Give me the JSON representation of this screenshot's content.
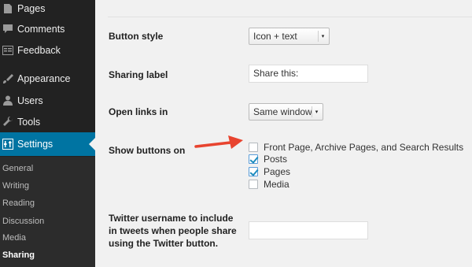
{
  "sidebar": {
    "items": [
      {
        "label": "Pages",
        "icon": "pages-icon"
      },
      {
        "label": "Comments",
        "icon": "comments-icon"
      },
      {
        "label": "Feedback",
        "icon": "feedback-icon"
      },
      {
        "label": "Appearance",
        "icon": "appearance-icon"
      },
      {
        "label": "Users",
        "icon": "users-icon"
      },
      {
        "label": "Tools",
        "icon": "tools-icon"
      },
      {
        "label": "Settings",
        "icon": "settings-icon"
      }
    ],
    "submenu": [
      "General",
      "Writing",
      "Reading",
      "Discussion",
      "Media",
      "Sharing"
    ],
    "active_item": "Settings",
    "current_submenu": "Sharing"
  },
  "form": {
    "button_style": {
      "label": "Button style",
      "value": "Icon + text"
    },
    "sharing_label": {
      "label": "Sharing label",
      "value": "Share this:"
    },
    "open_links": {
      "label": "Open links in",
      "value": "Same window"
    },
    "show_buttons": {
      "label": "Show buttons on",
      "options": [
        {
          "label": "Front Page, Archive Pages, and Search Results",
          "checked": false
        },
        {
          "label": "Posts",
          "checked": true
        },
        {
          "label": "Pages",
          "checked": true
        },
        {
          "label": "Media",
          "checked": false
        }
      ]
    },
    "twitter": {
      "label_line1": "Twitter username to include",
      "label_line2": "in tweets when people share",
      "label_line3": "using the Twitter button.",
      "value": ""
    }
  },
  "colors": {
    "sidebar_bg": "#222222",
    "active_bg": "#0074a2",
    "annotation_arrow": "#e8442f"
  }
}
